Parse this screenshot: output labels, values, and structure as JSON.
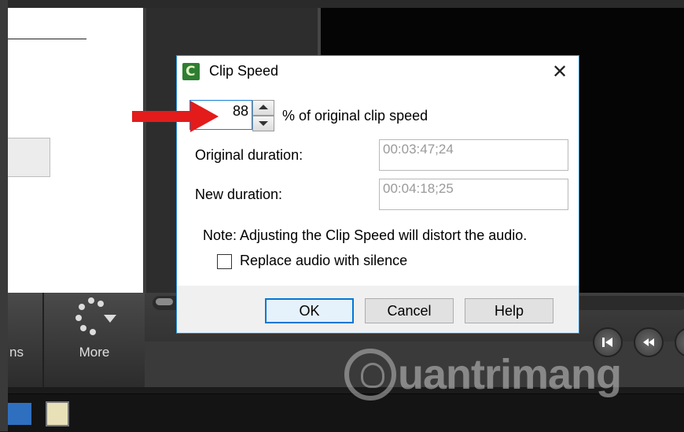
{
  "background": {
    "left_toolbar": {
      "partial_label": "ns",
      "more_label": "More"
    }
  },
  "dialog": {
    "title": "Clip Speed",
    "close_glyph": "✕",
    "speed_value": "88",
    "speed_suffix": "% of original clip speed",
    "original_duration_label": "Original duration:",
    "original_duration_value": "00:03:47;24",
    "new_duration_label": "New duration:",
    "new_duration_value": "00:04:18;25",
    "note": "Note: Adjusting the Clip Speed will distort the audio.",
    "checkbox_label": "Replace audio with silence",
    "checkbox_checked": false,
    "buttons": {
      "ok": "OK",
      "cancel": "Cancel",
      "help": "Help"
    }
  },
  "watermark": {
    "text": "uantrimang"
  },
  "colors": {
    "accent": "#0078d7",
    "arrow": "#e31b1b",
    "app_icon": "#2f7d32"
  }
}
